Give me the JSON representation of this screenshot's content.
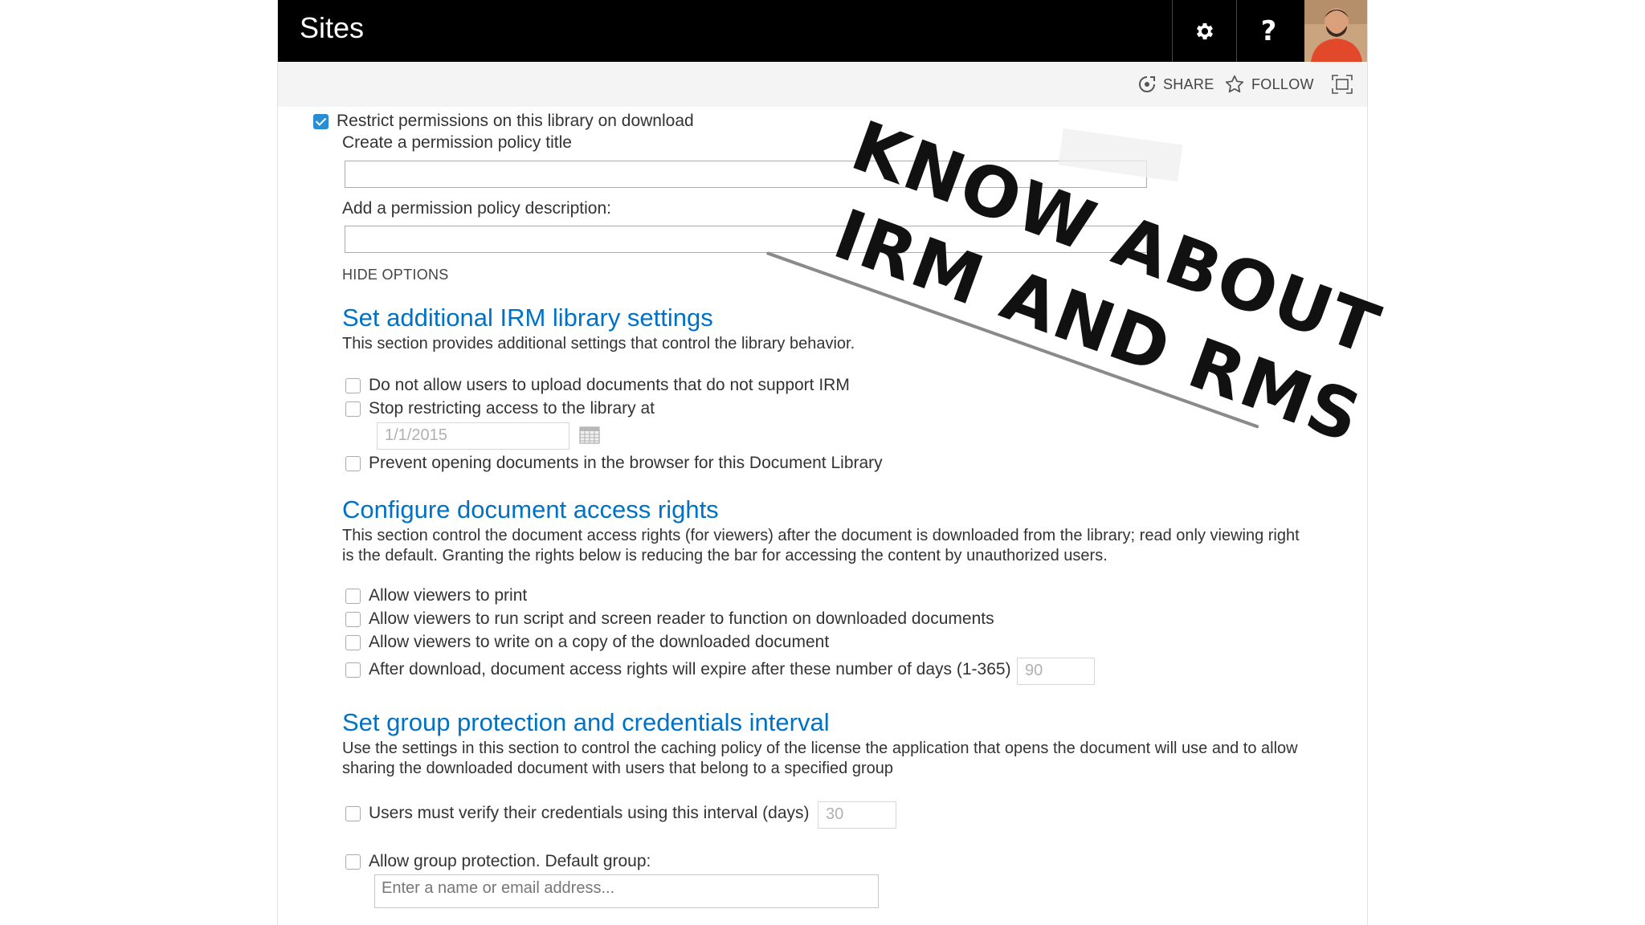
{
  "suite": {
    "title": "Sites",
    "settings_icon": "gear-icon",
    "help_label": "?",
    "avatar_icon": "user-avatar"
  },
  "ribbon": {
    "share_label": "SHARE",
    "follow_label": "FOLLOW",
    "share_icon": "share-icon",
    "follow_icon": "star-icon",
    "focus_icon": "focus-on-content-icon"
  },
  "permissions": {
    "restrict_label": "Restrict permissions on this library on download",
    "restrict_checked": true,
    "policy_title_label": "Create a permission policy title",
    "policy_title_value": "",
    "policy_desc_label": "Add a permission policy description:",
    "policy_desc_value": "",
    "hide_options_label": "HIDE OPTIONS"
  },
  "library_settings": {
    "heading": "Set additional IRM library settings",
    "description": "This section provides additional settings that control the library behavior.",
    "options": [
      {
        "label": "Do not allow users to upload documents that do not support IRM",
        "checked": false
      },
      {
        "label": "Stop restricting access to the library at",
        "checked": false
      },
      {
        "label": "Prevent opening documents in the browser for this Document Library",
        "checked": false
      }
    ],
    "stop_date_value": "1/1/2015",
    "calendar_icon": "calendar-icon"
  },
  "access_rights": {
    "heading": "Configure document access rights",
    "description": "This section control the document access rights (for viewers) after the document is downloaded from the library; read only viewing right is the default. Granting the rights below is reducing the bar for accessing the content by unauthorized users.",
    "options": [
      {
        "label": "Allow viewers to print",
        "checked": false
      },
      {
        "label": "Allow viewers to run script and screen reader to function on downloaded documents",
        "checked": false
      },
      {
        "label": "Allow viewers to write on a copy of the downloaded document",
        "checked": false
      },
      {
        "label": "After download, document access rights will expire after these number of days (1-365)",
        "checked": false
      }
    ],
    "expire_days_value": "90"
  },
  "group_protection": {
    "heading": "Set group protection and credentials interval",
    "description": "Use the settings in this section to control the caching policy of the license the application that opens the document will use and to allow sharing the downloaded document with users that belong to a specified group",
    "verify_label": "Users must verify their credentials using this interval (days)",
    "verify_checked": false,
    "verify_days_value": "30",
    "group_label": "Allow group protection. Default group:",
    "group_checked": false,
    "group_placeholder": "Enter a name or email address..."
  },
  "overlay": {
    "line1": "KNOW ABOUT",
    "line2": "IRM AND RMS"
  }
}
